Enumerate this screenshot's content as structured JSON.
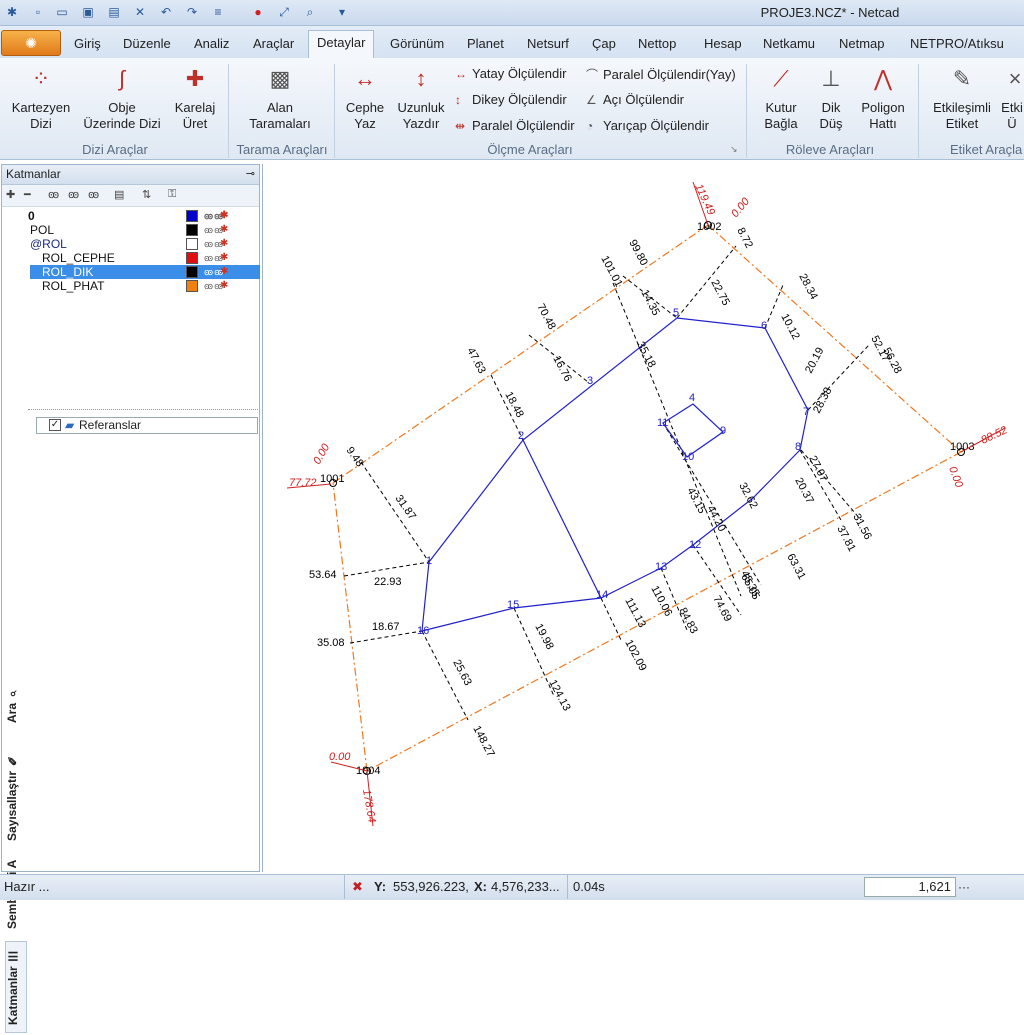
{
  "window": {
    "title": "PROJE3.NCZ* - Netcad"
  },
  "menu": {
    "tabs": [
      "Giriş",
      "Düzenle",
      "Analiz",
      "Araçlar",
      "Detaylar",
      "Görünüm",
      "Planet",
      "Netsurf",
      "Çap",
      "Nettop",
      "Hesap",
      "Netkamu",
      "Netmap",
      "NETPRO/Atıksu"
    ],
    "active_tab": "Detaylar"
  },
  "ribbon": {
    "kartezyen": "Kartezyen\nDizi",
    "obje": "Obje\nÜzerinde Dizi",
    "karelaj": "Karelaj\nÜret",
    "alan": "Alan\nTaramaları",
    "cephe": "Cephe\nYaz",
    "uzunluk": "Uzunluk\nYazdır",
    "yatay": "Yatay Ölçülendir",
    "dikey": "Dikey Ölçülendir",
    "paralel": "Paralel Ölçülendir",
    "paralel_yay": "Paralel Ölçülendir(Yay)",
    "aci": "Açı Ölçülendir",
    "yaricap": "Yarıçap Ölçülendir",
    "kutur": "Kutur\nBağla",
    "dik": "Dik\nDüş",
    "poligon": "Poligon\nHattı",
    "etkilesimli": "Etkileşimli\nEtiket",
    "etki2": "Etki\nÜ",
    "groups": {
      "dizi": "Dizi Araçlar",
      "tarama": "Tarama Araçları",
      "olcme": "Ölçme Araçları",
      "roleve": "Röleve Araçları",
      "etiket": "Etiket Araçla"
    }
  },
  "panel": {
    "title": "Katmanlar",
    "layers": [
      {
        "name": "0",
        "color": "#0000cc"
      },
      {
        "name": "POL",
        "color": "#000000"
      },
      {
        "name": "@ROL",
        "color": "#ffffff"
      },
      {
        "name": "ROL_CEPHE",
        "color": "#e01010"
      },
      {
        "name": "ROL_DIK",
        "color": "#000000"
      },
      {
        "name": "ROL_PHAT",
        "color": "#f08010"
      }
    ],
    "selected_layer": "ROL_DIK",
    "references": "Referanslar",
    "side_tabs": [
      "Ara",
      "Sayısallaştır",
      "Semboloji",
      "Katmanlar"
    ]
  },
  "drawing": {
    "points": [
      "1",
      "2",
      "3",
      "4",
      "5",
      "6",
      "7",
      "8",
      "9",
      "10",
      "11",
      "12",
      "13",
      "14",
      "15",
      "16",
      "1001",
      "1002",
      "1003",
      "1004"
    ],
    "measurements": [
      "9.48",
      "31.87",
      "53.64",
      "22.93",
      "35.08",
      "18.67",
      "25.63",
      "148.27",
      "19.98",
      "124.13",
      "102.09",
      "110.06",
      "111.13",
      "84.83",
      "74.69",
      "65.05",
      "63.31",
      "43.15",
      "44.20",
      "45.35",
      "32.62",
      "22.75",
      "8.72",
      "99.80",
      "14.35",
      "101.01",
      "35.18",
      "70.48",
      "16.76",
      "47.63",
      "18.48",
      "28.34",
      "10.12",
      "20.19",
      "28.38",
      "52.17",
      "56.28",
      "27.07",
      "20.37",
      "37.81",
      "31.56",
      "0.00",
      "77.72",
      "119.49",
      "88.52",
      "178.64"
    ]
  },
  "status": {
    "ready": "Hazır ...",
    "y_label": "Y:",
    "y_value": "553,926.223,",
    "x_label": "X:",
    "x_value": "4,576,233...",
    "time": "0.04s",
    "scale": "1,621"
  }
}
